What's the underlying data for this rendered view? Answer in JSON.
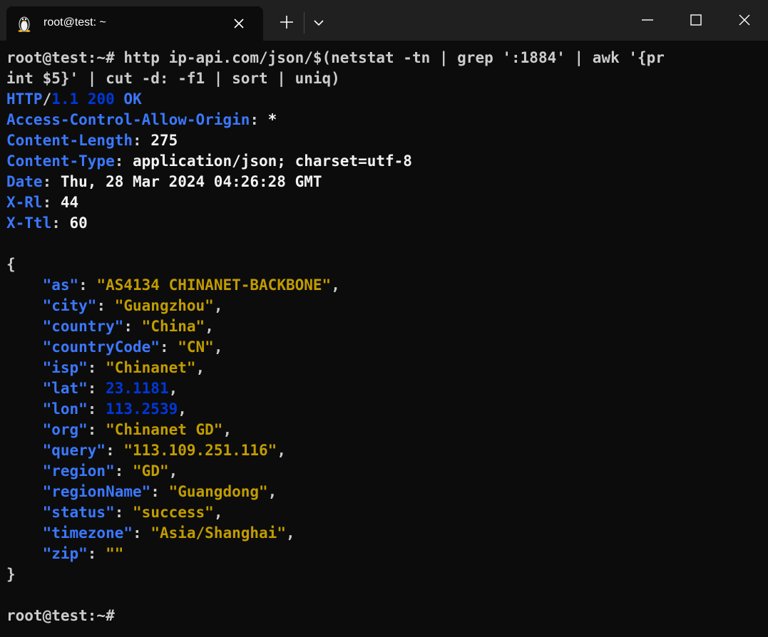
{
  "window": {
    "tab_title": "root@test: ~",
    "icons": {
      "tab": "linux-penguin-icon",
      "tab_close": "close-icon",
      "new_tab": "plus-icon",
      "dropdown": "chevron-down-icon",
      "minimize": "minimize-icon",
      "maximize": "maximize-icon",
      "close": "close-icon"
    }
  },
  "colors": {
    "background": "#0c0c0c",
    "titlebar": "#202020",
    "header_key": "#3b78ff",
    "status_number": "#0037da",
    "string_value": "#c19c00",
    "text": "#cccccc"
  },
  "terminal": {
    "command": {
      "prompt": "root@test:~#",
      "text_line1": " http ip-api.com/json/$(netstat -tn | grep ':1884' | awk '{pr",
      "text_line2": "int $5}' | cut -d: -f1 | sort | uniq)"
    },
    "status": {
      "protocol": "HTTP",
      "slash": "/",
      "version": "1.1",
      "code": "200",
      "reason": "OK"
    },
    "headers": [
      {
        "key": "Access-Control-Allow-Origin",
        "value": "*"
      },
      {
        "key": "Content-Length",
        "value": "275"
      },
      {
        "key": "Content-Type",
        "value": "application/json; charset=utf-8"
      },
      {
        "key": "Date",
        "value": "Thu, 28 Mar 2024 04:26:28 GMT"
      },
      {
        "key": "X-Rl",
        "value": "44"
      },
      {
        "key": "X-Ttl",
        "value": "60"
      }
    ],
    "json_open": "{",
    "json_close": "}",
    "json": [
      {
        "key": "\"as\"",
        "value": "\"AS4134 CHINANET-BACKBONE\"",
        "type": "string"
      },
      {
        "key": "\"city\"",
        "value": "\"Guangzhou\"",
        "type": "string"
      },
      {
        "key": "\"country\"",
        "value": "\"China\"",
        "type": "string"
      },
      {
        "key": "\"countryCode\"",
        "value": "\"CN\"",
        "type": "string"
      },
      {
        "key": "\"isp\"",
        "value": "\"Chinanet\"",
        "type": "string"
      },
      {
        "key": "\"lat\"",
        "value": "23.1181",
        "type": "number"
      },
      {
        "key": "\"lon\"",
        "value": "113.2539",
        "type": "number"
      },
      {
        "key": "\"org\"",
        "value": "\"Chinanet GD\"",
        "type": "string"
      },
      {
        "key": "\"query\"",
        "value": "\"113.109.251.116\"",
        "type": "string"
      },
      {
        "key": "\"region\"",
        "value": "\"GD\"",
        "type": "string"
      },
      {
        "key": "\"regionName\"",
        "value": "\"Guangdong\"",
        "type": "string"
      },
      {
        "key": "\"status\"",
        "value": "\"success\"",
        "type": "string"
      },
      {
        "key": "\"timezone\"",
        "value": "\"Asia/Shanghai\"",
        "type": "string"
      },
      {
        "key": "\"zip\"",
        "value": "\"\"",
        "type": "string",
        "last": true
      }
    ],
    "final_prompt": "root@test:~#"
  }
}
